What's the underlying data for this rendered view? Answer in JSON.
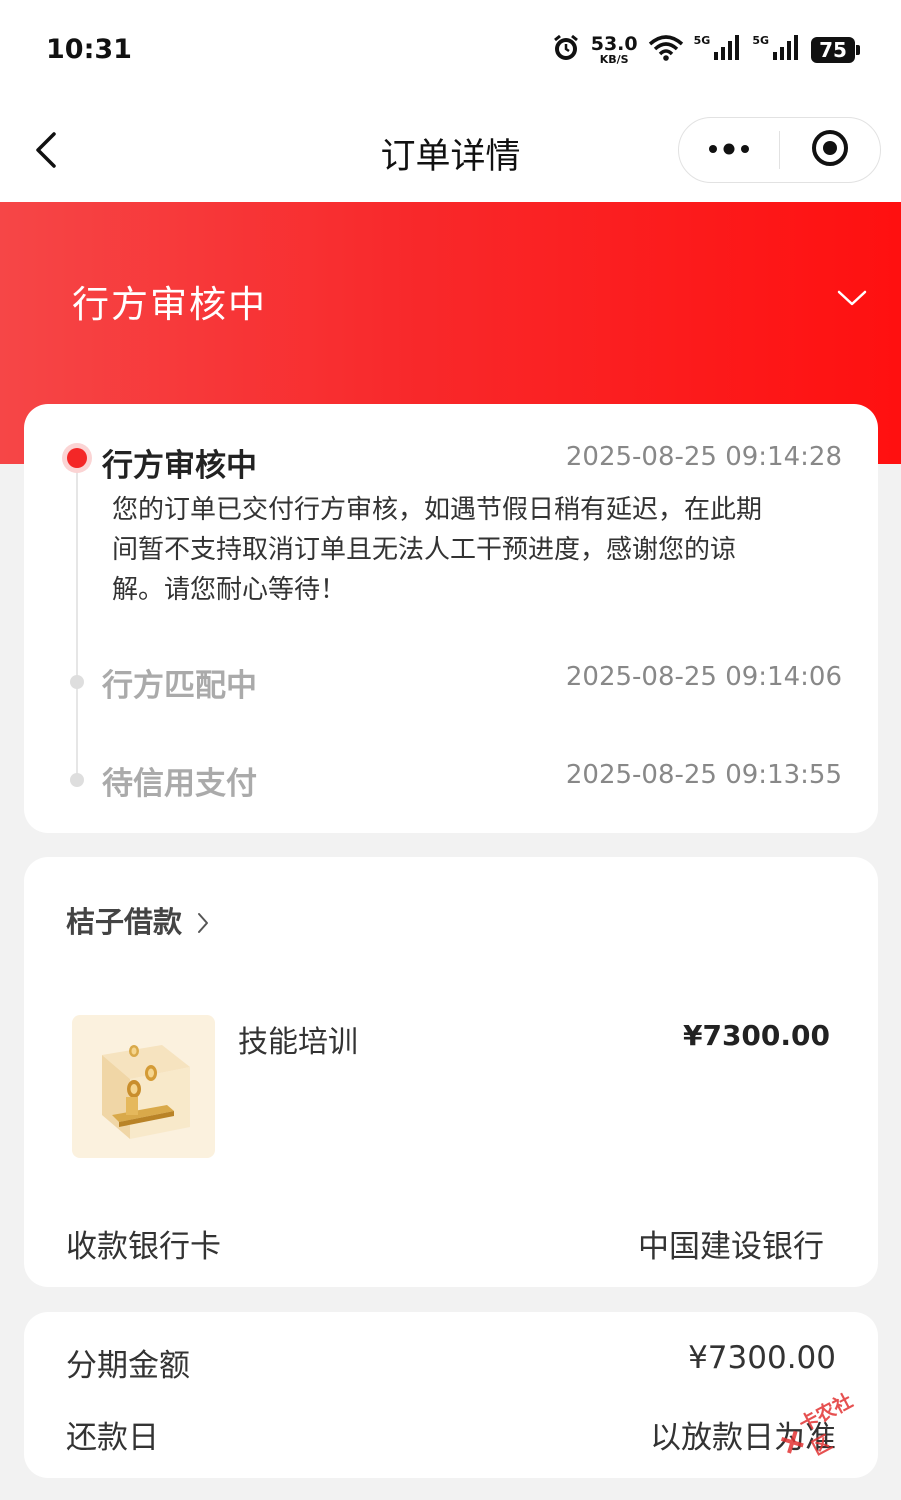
{
  "status_bar": {
    "time": "10:31",
    "net_speed_value": "53.0",
    "net_speed_unit": "KB/S",
    "signal_1_label": "5G",
    "signal_2_label": "5G",
    "battery": "75",
    "icons": [
      "alarm-icon",
      "wifi-icon",
      "signal-icon",
      "battery-icon"
    ]
  },
  "nav": {
    "title": "订单详情",
    "back_icon": "chevron-left-icon",
    "more_icon": "more-dots-icon",
    "close_icon": "target-circle-icon"
  },
  "hero": {
    "status_title": "行方审核中",
    "expand_icon": "chevron-down-icon",
    "gradient_from": "#f64647",
    "gradient_to": "#ff1010"
  },
  "timeline": {
    "steps": [
      {
        "title": "行方审核中",
        "time": "2025-08-25 09:14:28",
        "active": true,
        "description_lines": [
          "您的订单已交付行方审核，如遇节假日稍有延迟，在此期",
          "间暂不支持取消订单且无法人工干预进度，感谢您的谅",
          "解。请您耐心等待！"
        ]
      },
      {
        "title": "行方匹配中",
        "time": "2025-08-25 09:14:06",
        "active": false
      },
      {
        "title": "待信用支付",
        "time": "2025-08-25 09:13:55",
        "active": false
      }
    ],
    "active_color": "#f42727"
  },
  "order": {
    "merchant": "桔子借款",
    "product_name": "技能培训",
    "product_price": "¥7300.00",
    "product_image_icon": "coin-box-icon",
    "bank_card_label": "收款银行卡",
    "bank_card_value": "中国建设银行"
  },
  "installment": {
    "amount_label": "分期金额",
    "amount_value": "¥7300.00",
    "repay_day_label": "还款日",
    "repay_day_value": "以放款日为准"
  },
  "watermark": {
    "text": "卡农社区"
  }
}
